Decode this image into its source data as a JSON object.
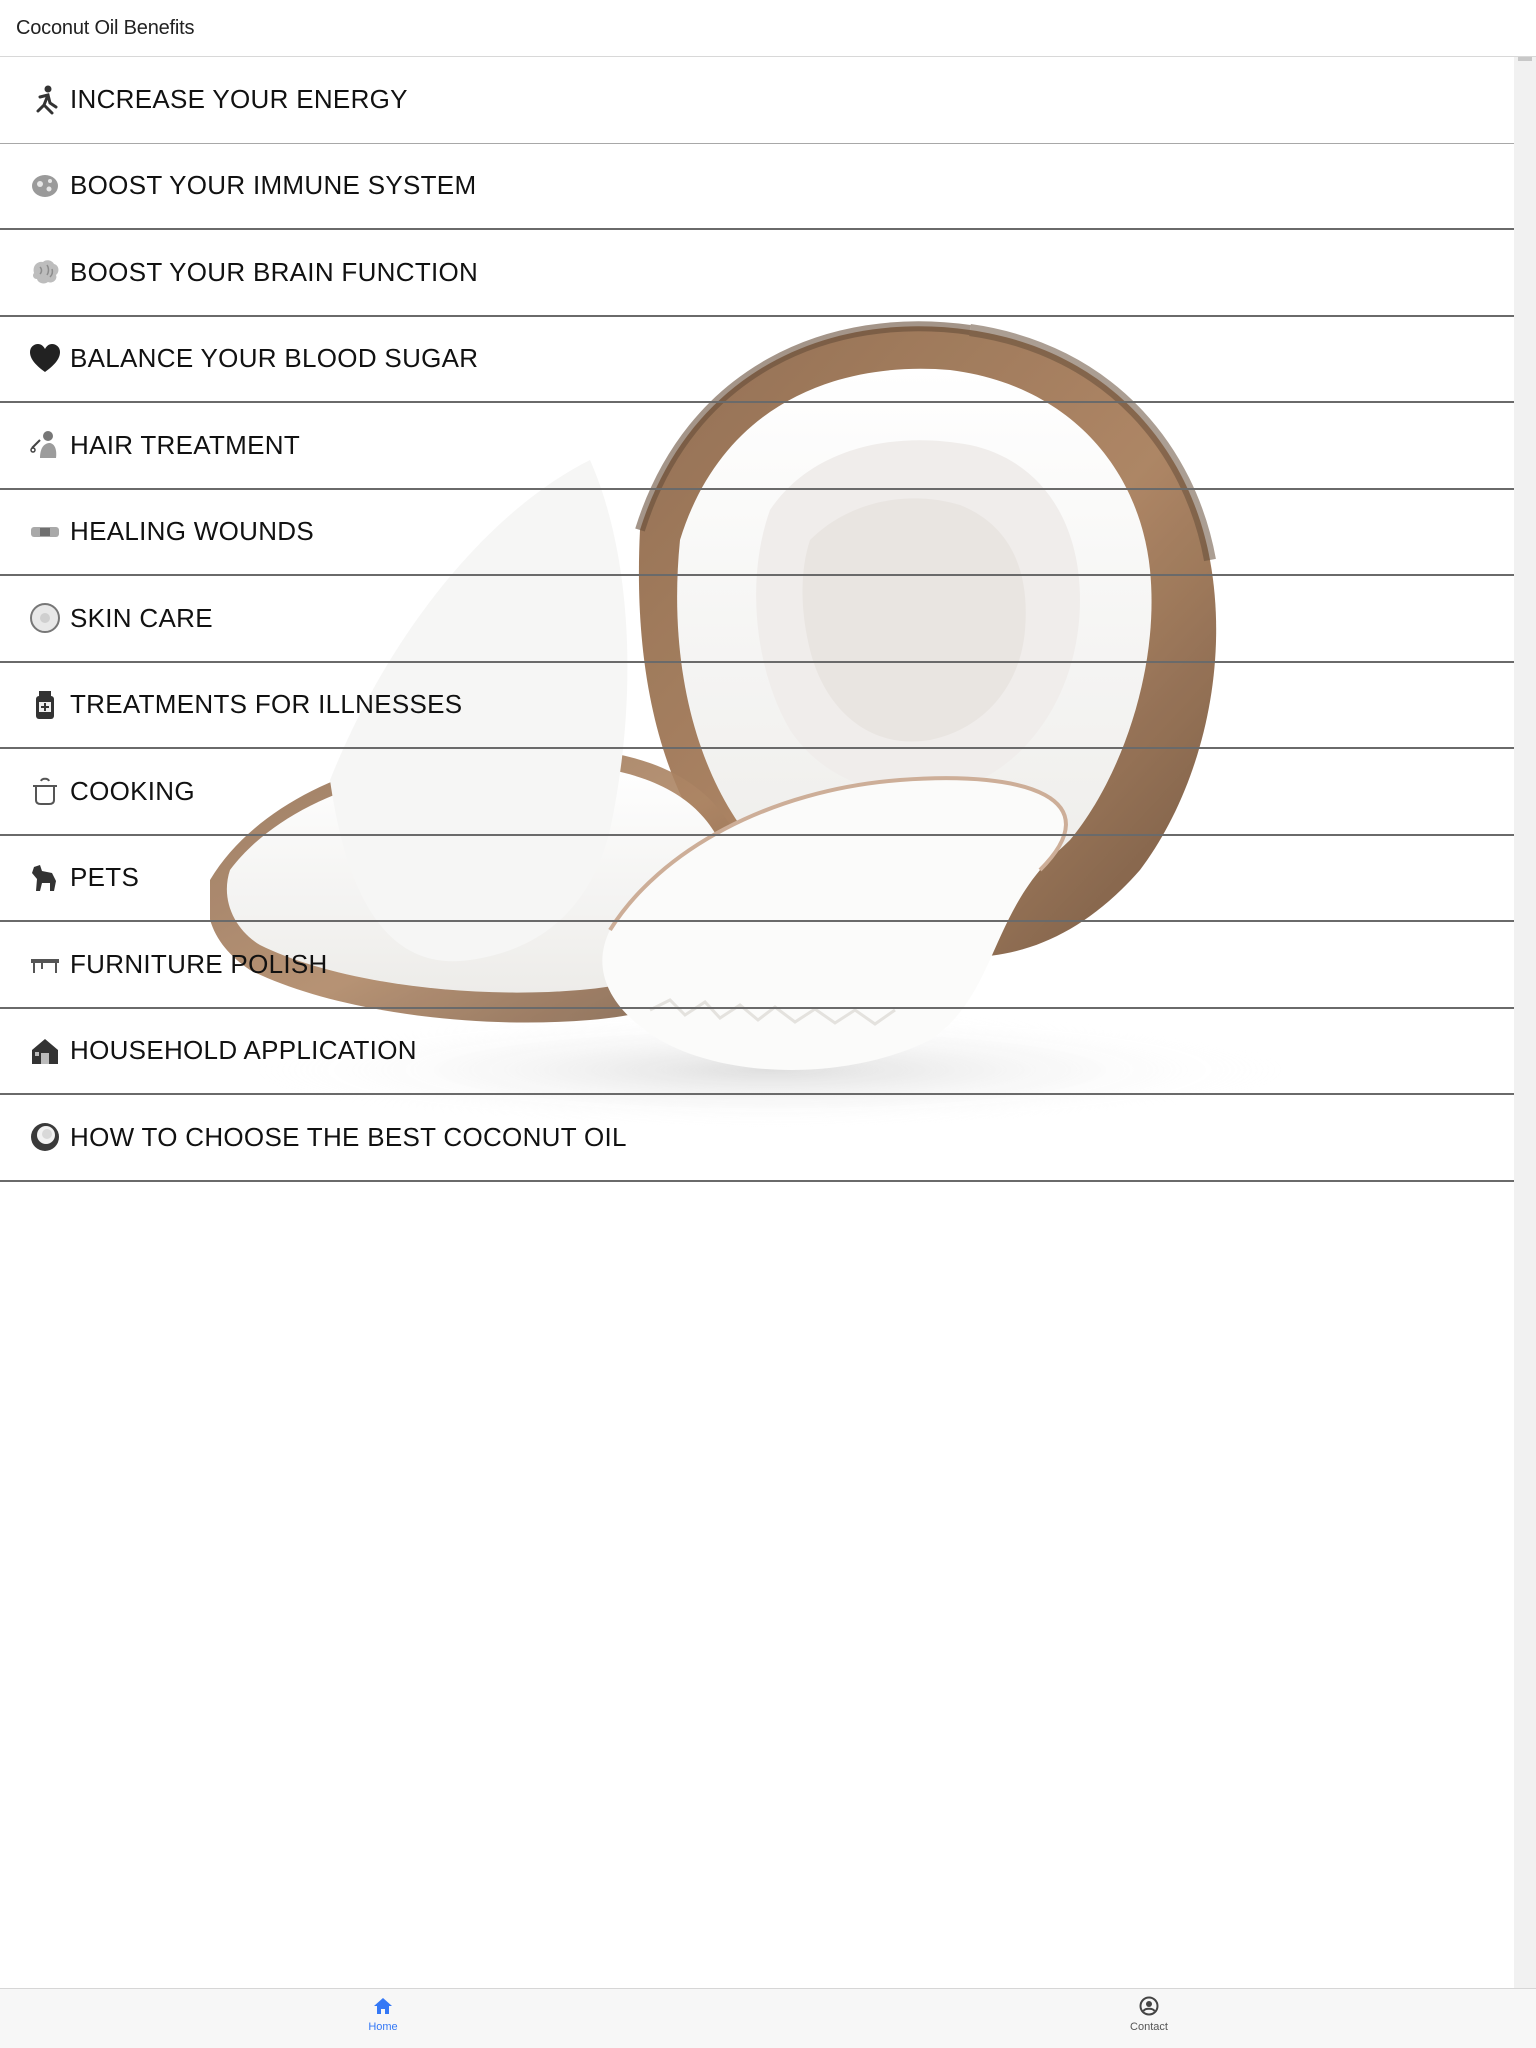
{
  "header": {
    "title": "Coconut Oil Benefits"
  },
  "menu": {
    "items": [
      {
        "label": "INCREASE YOUR ENERGY",
        "icon": "runner-icon"
      },
      {
        "label": "BOOST YOUR IMMUNE SYSTEM",
        "icon": "microbe-icon"
      },
      {
        "label": "BOOST YOUR BRAIN FUNCTION",
        "icon": "brain-icon"
      },
      {
        "label": "BALANCE YOUR BLOOD SUGAR",
        "icon": "heart-icon"
      },
      {
        "label": "HAIR TREATMENT",
        "icon": "haircut-icon"
      },
      {
        "label": "HEALING WOUNDS",
        "icon": "bandage-icon"
      },
      {
        "label": "SKIN CARE",
        "icon": "face-icon"
      },
      {
        "label": "TREATMENTS FOR ILLNESSES",
        "icon": "medicine-bottle-icon"
      },
      {
        "label": "COOKING",
        "icon": "cooking-pot-icon"
      },
      {
        "label": "PETS",
        "icon": "dog-icon"
      },
      {
        "label": "FURNITURE POLISH",
        "icon": "table-icon"
      },
      {
        "label": "HOUSEHOLD APPLICATION",
        "icon": "house-icon"
      },
      {
        "label": "HOW TO CHOOSE THE BEST COCONUT OIL",
        "icon": "coconut-icon"
      }
    ]
  },
  "tabbar": {
    "home_label": "Home",
    "contact_label": "Contact",
    "active_color": "#3478f6",
    "inactive_color": "#555555"
  }
}
